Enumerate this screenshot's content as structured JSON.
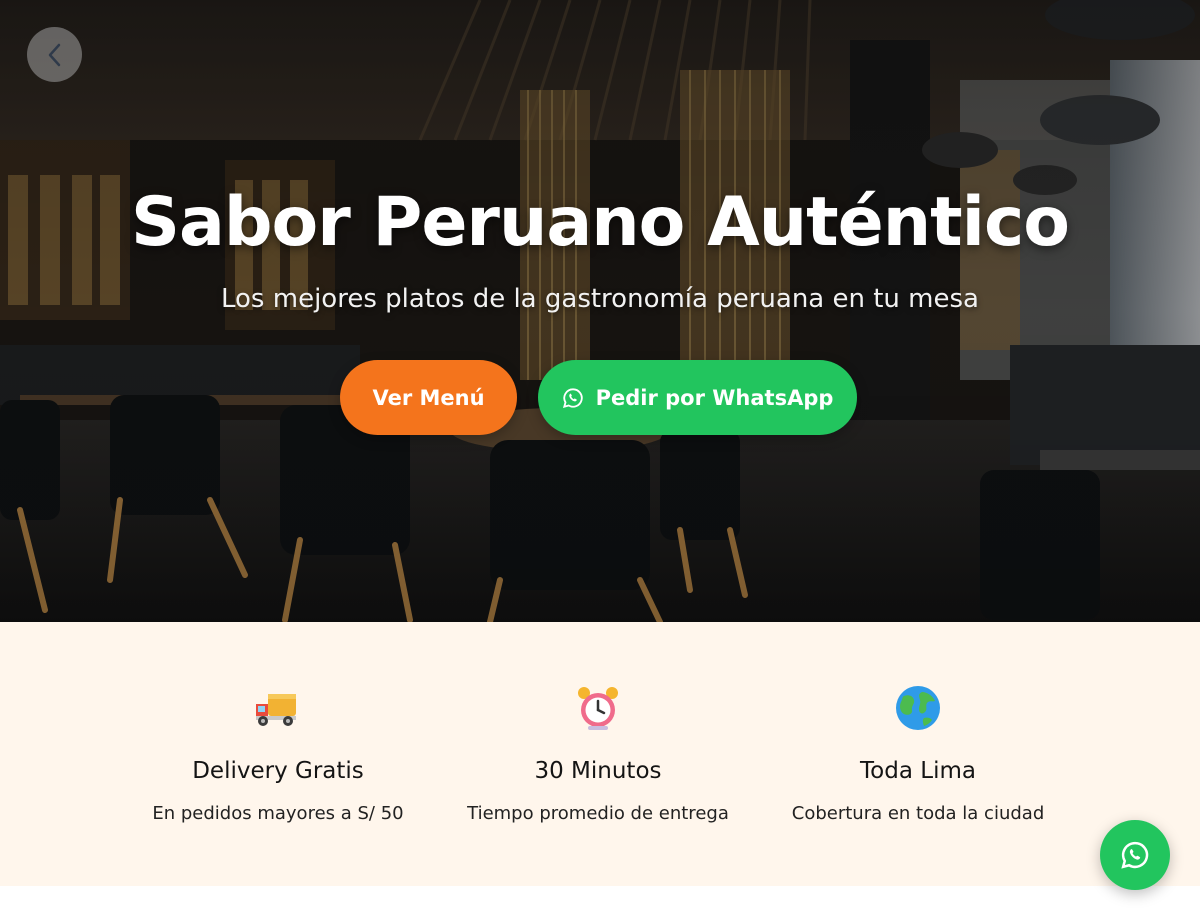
{
  "hero": {
    "title": "Sabor Peruano Auténtico",
    "subtitle": "Los mejores platos de la gastronomía peruana en tu mesa",
    "menu_button_label": "Ver Menú",
    "whatsapp_button_label": "Pedir por WhatsApp",
    "back_icon": "chevron-left-icon",
    "background_image": "restaurant-interior-photo"
  },
  "features": [
    {
      "icon": "delivery-truck-icon",
      "title": "Delivery Gratis",
      "description": "En pedidos mayores a S/ 50"
    },
    {
      "icon": "alarm-clock-icon",
      "title": "30 Minutos",
      "description": "Tiempo promedio de entrega"
    },
    {
      "icon": "globe-icon",
      "title": "Toda Lima",
      "description": "Cobertura en toda la ciudad"
    }
  ],
  "floating_button": {
    "icon": "whatsapp-icon"
  },
  "colors": {
    "accent_orange": "#f4741c",
    "whatsapp_green": "#22c55e",
    "features_bg": "#fff6ec"
  }
}
